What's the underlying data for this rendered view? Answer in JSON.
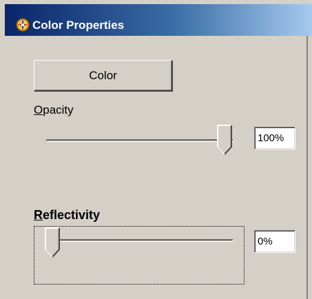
{
  "window": {
    "title": "Color Properties",
    "icon": "color-wheel-icon"
  },
  "color_button": {
    "label": "Color"
  },
  "opacity": {
    "label_accel": "O",
    "label_rest": "pacity",
    "value_text": "100%",
    "level_percent": 100
  },
  "reflectivity": {
    "label_accel": "R",
    "label_rest": "eflectivity",
    "value_text": "0%",
    "level_percent": 0
  },
  "colors": {
    "face": "#d4d0c8",
    "title_start": "#0a246a",
    "title_end": "#a6caf0",
    "title_text": "#ffffff"
  }
}
